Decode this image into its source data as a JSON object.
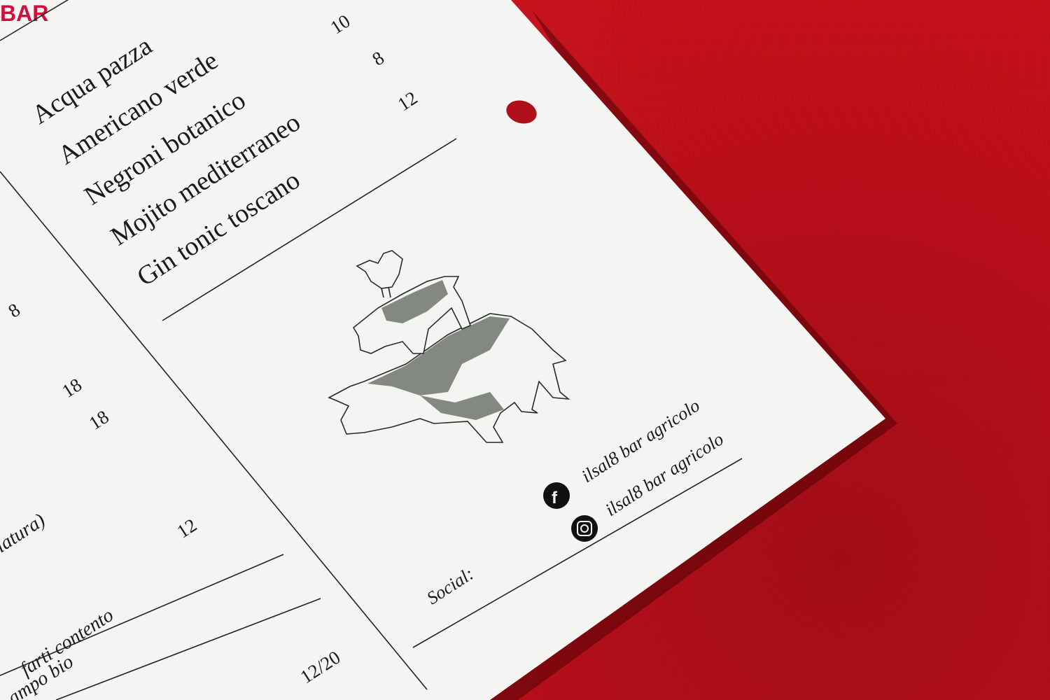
{
  "colors": {
    "background": "#c8101c",
    "card": "#f4f4f2",
    "ink": "#1a1a1a",
    "accent": "#d0103c"
  },
  "menu": {
    "section_title": "BAR",
    "items": [
      {
        "name": "Acqua pazza",
        "price": "10"
      },
      {
        "name": "Americano verde",
        "price": "8"
      },
      {
        "name": "Negroni botanico",
        "price": "12"
      },
      {
        "name": "Mojito mediterraneo",
        "price": ""
      },
      {
        "name": "Gin tonic toscano",
        "price": ""
      }
    ]
  },
  "left_column": {
    "prices": [
      "8",
      "18",
      "18",
      "12",
      "12/20"
    ],
    "fragments": [
      "llatura)",
      "farti contento",
      "ampo bio"
    ]
  },
  "social": {
    "label": "Social:",
    "facebook_icon": "facebook-icon",
    "instagram_icon": "instagram-icon",
    "facebook_handle": "ilsal8 bar agricolo",
    "instagram_handle": "ilsal8 bar agricolo"
  },
  "illustration": {
    "icon": "stacked-farm-animals-engraving"
  }
}
